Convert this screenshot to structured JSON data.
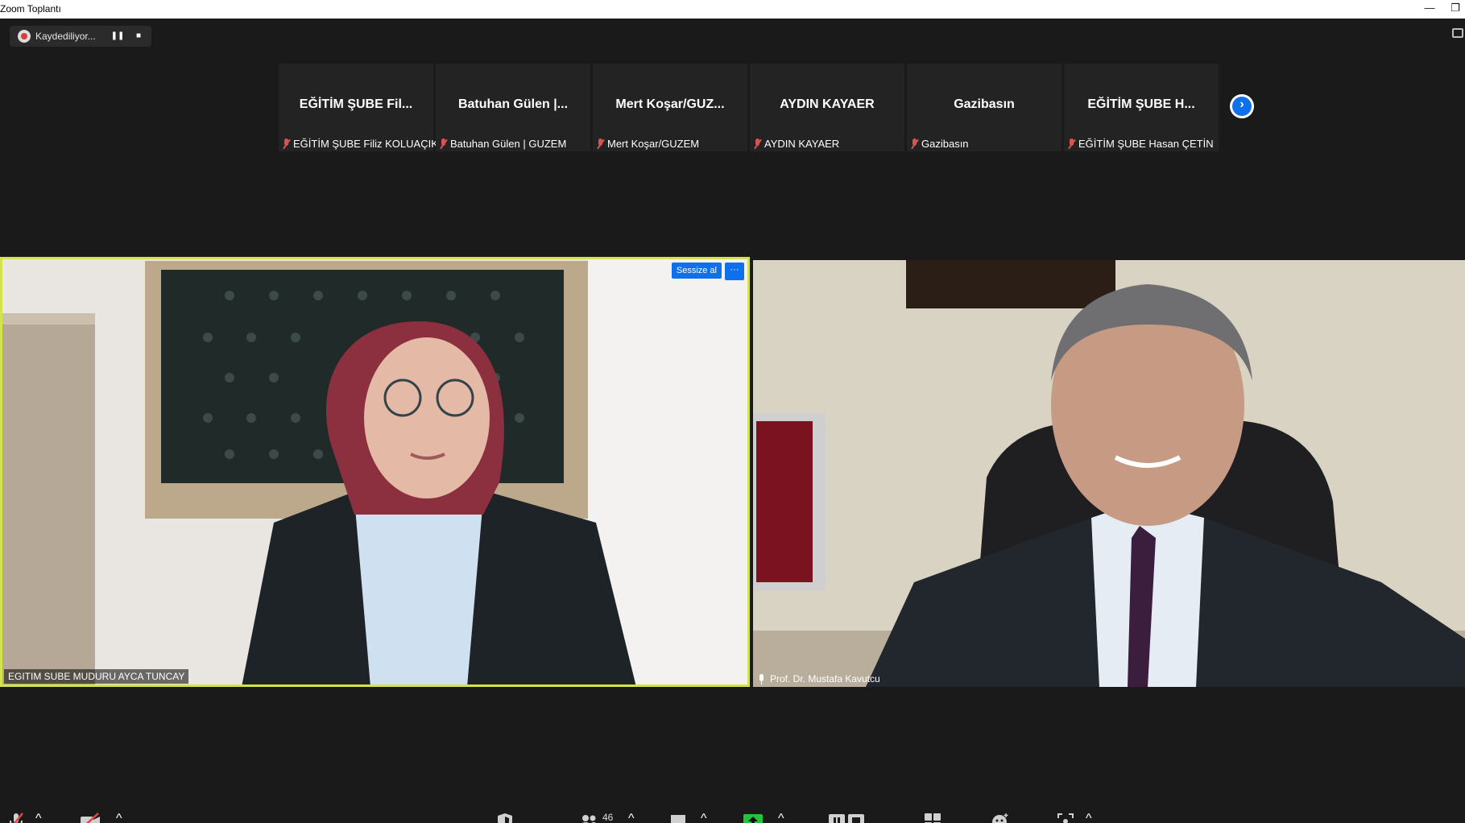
{
  "window": {
    "title": "Zoom Toplantı",
    "minimize": "—",
    "restore": "❐"
  },
  "recording": {
    "label": "Kaydediliyor...",
    "pause": "❚❚",
    "stop": "■"
  },
  "filmstrip": [
    {
      "name": "EĞİTİM ŞUBE Fil...",
      "label": "EĞİTİM ŞUBE Filiz KOLUAÇIK"
    },
    {
      "name": "Batuhan Gülen |...",
      "label": "Batuhan Gülen | GUZEM"
    },
    {
      "name": "Mert Koşar/GUZ...",
      "label": "Mert Koşar/GUZEM"
    },
    {
      "name": "AYDIN KAYAER",
      "label": "AYDIN KAYAER"
    },
    {
      "name": "Gazibasın",
      "label": "Gazibasın"
    },
    {
      "name": "EĞİTİM ŞUBE H...",
      "label": "EĞİTİM ŞUBE Hasan ÇETİN"
    }
  ],
  "next_arrow": "›",
  "videos": {
    "left": {
      "name": "EGITIM SUBE MUDURU AYCA TUNCAY",
      "mute_label": "Sessize al",
      "more_label": "···"
    },
    "right": {
      "name": "Prof. Dr. Mustafa Kavutcu"
    }
  },
  "toolbar": {
    "participants_count": "46",
    "caret": "^"
  },
  "colors": {
    "accent": "#0e71eb",
    "active_speaker": "#d3e34b",
    "muted": "#d9534f",
    "share": "#23c33d"
  }
}
